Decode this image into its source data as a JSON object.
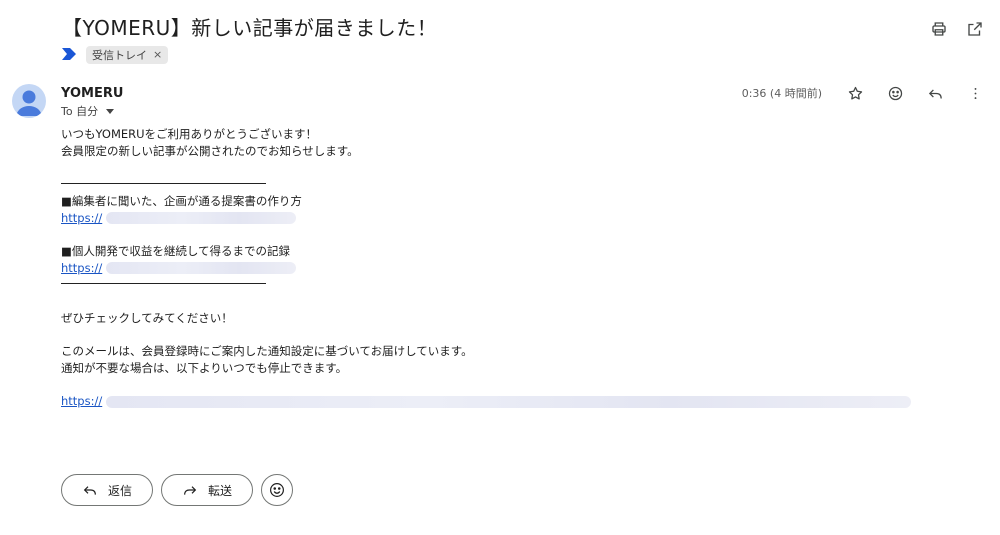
{
  "email": {
    "subject": "【YOMERU】新しい記事が届きました！",
    "label": "受信トレイ",
    "label_close": "×",
    "sender": "YOMERU",
    "recipient": "To 自分",
    "time": "0:36 (4 時間前)",
    "body": {
      "greeting": "いつもYOMERUをご利用ありがとうございます！",
      "intro": "会員限定の新しい記事が公開されたのでお知らせします。",
      "articles": [
        {
          "title": "■編集者に聞いた、企画が通る提案書の作り方",
          "link": "https://"
        },
        {
          "title": "■個人開発で収益を継続して得るまでの記録",
          "link": "https://"
        }
      ],
      "cta": "ぜひチェックしてみてください！",
      "notice1": "このメールは、会員登録時にご案内した通知設定に基づいてお届けしています。",
      "notice2": "通知が不要な場合は、以下よりいつでも停止できます。",
      "unsubscribe_link": "https://"
    }
  },
  "actions": {
    "reply": "返信",
    "forward": "転送"
  },
  "icons": {
    "print": "print-icon",
    "open_new": "open-in-new-icon",
    "star": "star-icon",
    "emoji": "emoji-icon",
    "reply": "reply-icon",
    "more": "more-vert-icon",
    "importance": "importance-marker-icon",
    "forward": "forward-icon"
  },
  "colors": {
    "link": "#1a55c4",
    "importance": "#1a56d6",
    "avatar_bg": "#c4d7f5"
  }
}
